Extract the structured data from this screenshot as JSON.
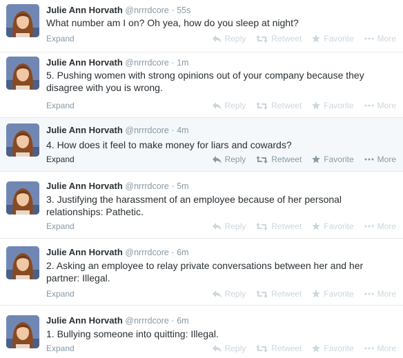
{
  "tweets": [
    {
      "name": "Julie Ann Horvath",
      "handle": "@nrrrdcore",
      "time": "55s",
      "text": "What number am I on? Oh yea, how do you sleep at night?",
      "expand": "Expand",
      "reply": "Reply",
      "retweet": "Retweet",
      "favorite": "Favorite",
      "more": "More"
    },
    {
      "name": "Julie Ann Horvath",
      "handle": "@nrrrdcore",
      "time": "1m",
      "text": "5. Pushing women with strong opinions out of your company because they disagree with you is wrong.",
      "expand": "Expand",
      "reply": "Reply",
      "retweet": "Retweet",
      "favorite": "Favorite",
      "more": "More"
    },
    {
      "name": "Julie Ann Horvath",
      "handle": "@nrrrdcore",
      "time": "4m",
      "text": "4. How does it feel to make money for liars and cowards?",
      "expand": "Expand",
      "reply": "Reply",
      "retweet": "Retweet",
      "favorite": "Favorite",
      "more": "More"
    },
    {
      "name": "Julie Ann Horvath",
      "handle": "@nrrrdcore",
      "time": "5m",
      "text": "3. Justifying the harassment of an employee because of her personal relationships: Pathetic.",
      "expand": "Expand",
      "reply": "Reply",
      "retweet": "Retweet",
      "favorite": "Favorite",
      "more": "More"
    },
    {
      "name": "Julie Ann Horvath",
      "handle": "@nrrrdcore",
      "time": "6m",
      "text": "2. Asking an employee to relay private conversations between her and her partner: Illegal.",
      "expand": "Expand",
      "reply": "Reply",
      "retweet": "Retweet",
      "favorite": "Favorite",
      "more": "More"
    },
    {
      "name": "Julie Ann Horvath",
      "handle": "@nrrrdcore",
      "time": "6m",
      "text": "1. Bullying someone into quitting: Illegal.",
      "expand": "Expand",
      "reply": "Reply",
      "retweet": "Retweet",
      "favorite": "Favorite",
      "more": "More"
    }
  ],
  "icons": {
    "reply": "reply-icon",
    "retweet": "retweet-icon",
    "favorite": "star-icon",
    "more": "more-dots-icon"
  },
  "colors": {
    "name": "#292f33",
    "meta": "#8899a6",
    "faded_action": "#ccd6dd",
    "hover_bg": "#f5f8fa",
    "divider": "#e8e8e8"
  }
}
